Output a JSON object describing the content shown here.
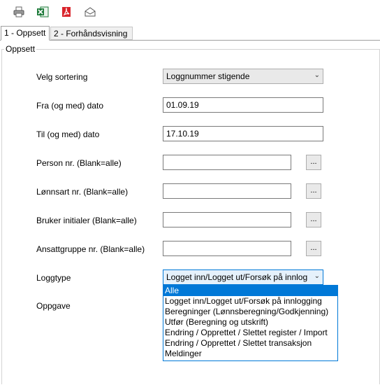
{
  "toolbar": {
    "icons": [
      "printer-icon",
      "excel-icon",
      "pdf-icon",
      "email-icon"
    ]
  },
  "tabs": [
    {
      "label": "1 - Oppsett",
      "active": true
    },
    {
      "label": "2 - Forhåndsvisning",
      "active": false
    }
  ],
  "group": {
    "legend": "Oppsett"
  },
  "form": {
    "sorting": {
      "label": "Velg sortering",
      "value": "Loggnummer stigende"
    },
    "from_date": {
      "label": "Fra (og med) dato",
      "value": "01.09.19"
    },
    "to_date": {
      "label": "Til (og med) dato",
      "value": "17.10.19"
    },
    "person": {
      "label": "Person nr. (Blank=alle)",
      "value": "",
      "button": "..."
    },
    "wage_type": {
      "label": "Lønnsart nr. (Blank=alle)",
      "value": "",
      "button": "..."
    },
    "user_initials": {
      "label": "Bruker initialer (Blank=alle)",
      "value": "",
      "button": "..."
    },
    "employee_group": {
      "label": "Ansattgruppe nr. (Blank=alle)",
      "value": "",
      "button": "..."
    },
    "log_type": {
      "label": "Loggtype",
      "value": "Logget inn/Logget ut/Forsøk på innlog"
    },
    "task": {
      "label": "Oppgave"
    }
  },
  "log_type_options": [
    "Alle",
    "Logget inn/Logget ut/Forsøk på innlogging",
    "Beregninger (Lønnsberegning/Godkjenning)",
    "Utfør (Beregning og utskrift)",
    "Endring / Opprettet / Slettet register / Import",
    "Endring / Opprettet / Slettet transaksjon",
    "Meldinger"
  ],
  "highlighted_option": "Alle",
  "colors": {
    "selection": "#0078d7"
  }
}
